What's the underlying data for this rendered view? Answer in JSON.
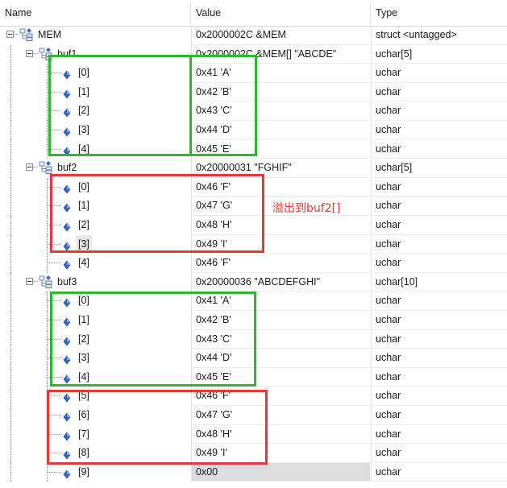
{
  "columns": {
    "name": "Name",
    "value": "Value",
    "type": "Type"
  },
  "rows": [
    {
      "indent": 0,
      "kind": "struct",
      "expanded": true,
      "name": "MEM",
      "value": "0x2000002C &MEM",
      "type": "struct <untagged>"
    },
    {
      "indent": 1,
      "kind": "struct",
      "expanded": true,
      "name": "buf1",
      "value": "0x2000002C &MEM[] \"ABCDE\"",
      "type": "uchar[5]"
    },
    {
      "indent": 2,
      "kind": "item",
      "name": "[0]",
      "value": "0x41 'A'",
      "type": "uchar"
    },
    {
      "indent": 2,
      "kind": "item",
      "name": "[1]",
      "value": "0x42 'B'",
      "type": "uchar"
    },
    {
      "indent": 2,
      "kind": "item",
      "name": "[2]",
      "value": "0x43 'C'",
      "type": "uchar"
    },
    {
      "indent": 2,
      "kind": "item",
      "name": "[3]",
      "value": "0x44 'D'",
      "type": "uchar"
    },
    {
      "indent": 2,
      "kind": "item",
      "name": "[4]",
      "value": "0x45 'E'",
      "type": "uchar"
    },
    {
      "indent": 1,
      "kind": "struct",
      "expanded": true,
      "name": "buf2",
      "value": "0x20000031 \"FGHIF\"",
      "type": "uchar[5]"
    },
    {
      "indent": 2,
      "kind": "item",
      "name": "[0]",
      "value": "0x46 'F'",
      "type": "uchar"
    },
    {
      "indent": 2,
      "kind": "item",
      "name": "[1]",
      "value": "0x47 'G'",
      "type": "uchar"
    },
    {
      "indent": 2,
      "kind": "item",
      "name": "[2]",
      "value": "0x48 'H'",
      "type": "uchar"
    },
    {
      "indent": 2,
      "kind": "item",
      "name": "[3]",
      "value": "0x49 'I'",
      "type": "uchar",
      "selected": true
    },
    {
      "indent": 2,
      "kind": "item",
      "name": "[4]",
      "value": "0x46 'F'",
      "type": "uchar"
    },
    {
      "indent": 1,
      "kind": "struct",
      "expanded": true,
      "name": "buf3",
      "value": "0x20000036 \"ABCDEFGHI\"",
      "type": "uchar[10]"
    },
    {
      "indent": 2,
      "kind": "item",
      "name": "[0]",
      "value": "0x41 'A'",
      "type": "uchar"
    },
    {
      "indent": 2,
      "kind": "item",
      "name": "[1]",
      "value": "0x42 'B'",
      "type": "uchar"
    },
    {
      "indent": 2,
      "kind": "item",
      "name": "[2]",
      "value": "0x43 'C'",
      "type": "uchar"
    },
    {
      "indent": 2,
      "kind": "item",
      "name": "[3]",
      "value": "0x44 'D'",
      "type": "uchar"
    },
    {
      "indent": 2,
      "kind": "item",
      "name": "[4]",
      "value": "0x45 'E'",
      "type": "uchar"
    },
    {
      "indent": 2,
      "kind": "item",
      "name": "[5]",
      "value": "0x46 'F'",
      "type": "uchar"
    },
    {
      "indent": 2,
      "kind": "item",
      "name": "[6]",
      "value": "0x47 'G'",
      "type": "uchar"
    },
    {
      "indent": 2,
      "kind": "item",
      "name": "[7]",
      "value": "0x48 'H'",
      "type": "uchar"
    },
    {
      "indent": 2,
      "kind": "item",
      "name": "[8]",
      "value": "0x49 'I'",
      "type": "uchar"
    },
    {
      "indent": 2,
      "kind": "item",
      "name": "[9]",
      "value": "0x00",
      "type": "uchar",
      "fade": true
    }
  ],
  "annotation": {
    "text": "溢出到buf2[]",
    "color": "#e53935"
  },
  "highlight_colors": {
    "green": "#2eb82e",
    "red": "#e53935"
  },
  "icons": {
    "struct": "struct-tree-icon",
    "item": "diamond-item-icon",
    "toggle": "collapse-minus-icon"
  }
}
